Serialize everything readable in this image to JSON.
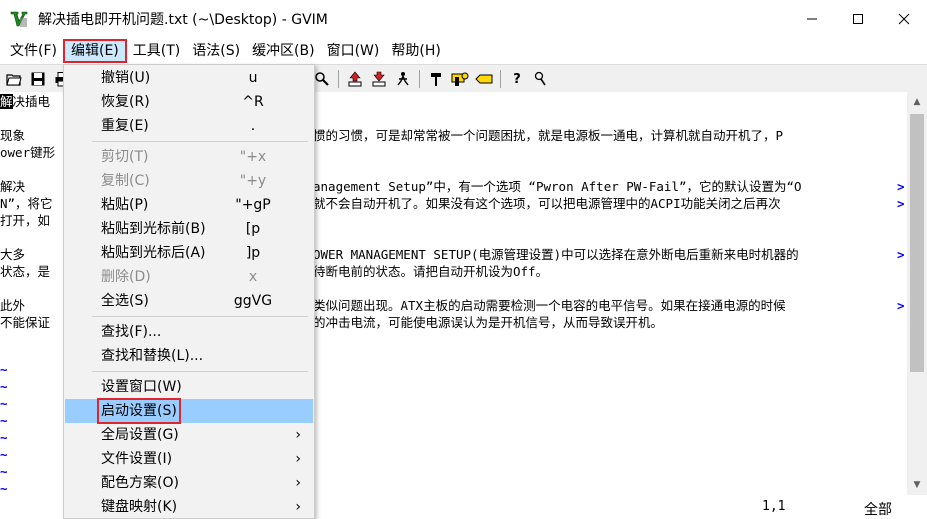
{
  "window": {
    "title": "解决插电即开机问题.txt (~\\Desktop) - GVIM",
    "controls": [
      "minimize-icon",
      "maximize-icon",
      "close-icon"
    ]
  },
  "menubar": {
    "items": [
      "文件(F)",
      "编辑(E)",
      "工具(T)",
      "语法(S)",
      "缓冲区(B)",
      "窗口(W)",
      "帮助(H)"
    ],
    "active_index": 1
  },
  "toolbar": {
    "left_icons": [
      "open-icon",
      "save-icon",
      "print-icon"
    ],
    "right_icons": [
      "load-session-icon",
      "save-session-icon",
      "run-script-icon",
      "make-icon",
      "shell-icon",
      "ctags-icon",
      "help-icon",
      "find-help-icon"
    ],
    "right_glyphs": [
      "⇧",
      "⇩",
      "♞",
      "⊤",
      "⬒",
      "▭",
      "?",
      "⚲"
    ]
  },
  "editor": {
    "lines": [
      {
        "text": "决插电",
        "cursor": "解"
      },
      {
        "text": ""
      },
      {
        "text": "    现象",
        "rest": "惯的习惯，可是却常常被一个问题困扰，就是电源板一通电，计算机就自动开机了，P"
      },
      {
        "text": "ower键形",
        "rest": ""
      },
      {
        "text": ""
      },
      {
        "text": "    解决",
        "rest": "anagement Setup”中，有一个选项 “Pwron After PW-Fail”，它的默认设置为“O"
      },
      {
        "text": "N”，将它",
        "rest": "就不会自动开机了。如果没有这个选项，可以把电源管理中的ACPI功能关闭之后再次"
      },
      {
        "text": "打开，如",
        "rest": ""
      },
      {
        "text": ""
      },
      {
        "text": "    大多",
        "rest": "OWER MANAGEMENT SETUP(电源管理设置)中可以选择在意外断电后重新来电时机器的"
      },
      {
        "text": "状态，是",
        "rest": "待断电前的状态。请把自动开机设为Off。"
      },
      {
        "text": ""
      },
      {
        "text": "    此外",
        "rest": "类似问题出现。ATX主板的启动需要检测一个电容的电平信号。如果在接通电源的时候"
      },
      {
        "text": "不能保证",
        "rest": "的冲击电流，可能使电源误认为是开机信号，从而导致误开机。"
      }
    ],
    "wrap_marks": [
      5,
      6,
      9,
      12
    ],
    "tilde": "~",
    "tilde_count": 8
  },
  "status": {
    "position": "1,1",
    "percent": "全部"
  },
  "edit_menu": {
    "items": [
      {
        "label": "撤销(U)",
        "accel": "u",
        "disabled": false
      },
      {
        "label": "恢复(R)",
        "accel": "^R",
        "disabled": false
      },
      {
        "label": "重复(E)",
        "accel": ".",
        "disabled": false
      },
      {
        "sep": true
      },
      {
        "label": "剪切(T)",
        "accel": "\"+x",
        "disabled": true
      },
      {
        "label": "复制(C)",
        "accel": "\"+y",
        "disabled": true
      },
      {
        "label": "粘贴(P)",
        "accel": "\"+gP",
        "disabled": false
      },
      {
        "label": "粘贴到光标前(B)",
        "accel": "[p",
        "disabled": false
      },
      {
        "label": "粘贴到光标后(A)",
        "accel": "]p",
        "disabled": false
      },
      {
        "label": "删除(D)",
        "accel": "x",
        "disabled": true
      },
      {
        "label": "全选(S)",
        "accel": "ggVG",
        "disabled": false
      },
      {
        "sep": true
      },
      {
        "label": "查找(F)...",
        "accel": "",
        "disabled": false
      },
      {
        "label": "查找和替换(L)...",
        "accel": "",
        "disabled": false
      },
      {
        "sep": true
      },
      {
        "label": "设置窗口(W)",
        "accel": "",
        "disabled": false
      },
      {
        "label": "启动设置(S)",
        "accel": "",
        "disabled": false,
        "highlight": true
      },
      {
        "label": "全局设置(G)",
        "accel": "",
        "disabled": false,
        "submenu": true
      },
      {
        "label": "文件设置(I)",
        "accel": "",
        "disabled": false,
        "submenu": true
      },
      {
        "label": "配色方案(O)",
        "accel": "",
        "disabled": false,
        "submenu": true
      },
      {
        "label": "键盘映射(K)",
        "accel": "",
        "disabled": false,
        "submenu": true
      }
    ],
    "submenu_glyph": "›"
  },
  "colors": {
    "highlight": "#99ccff",
    "annotation_red": "#e0252b",
    "tilde_blue": "#0000ff"
  }
}
